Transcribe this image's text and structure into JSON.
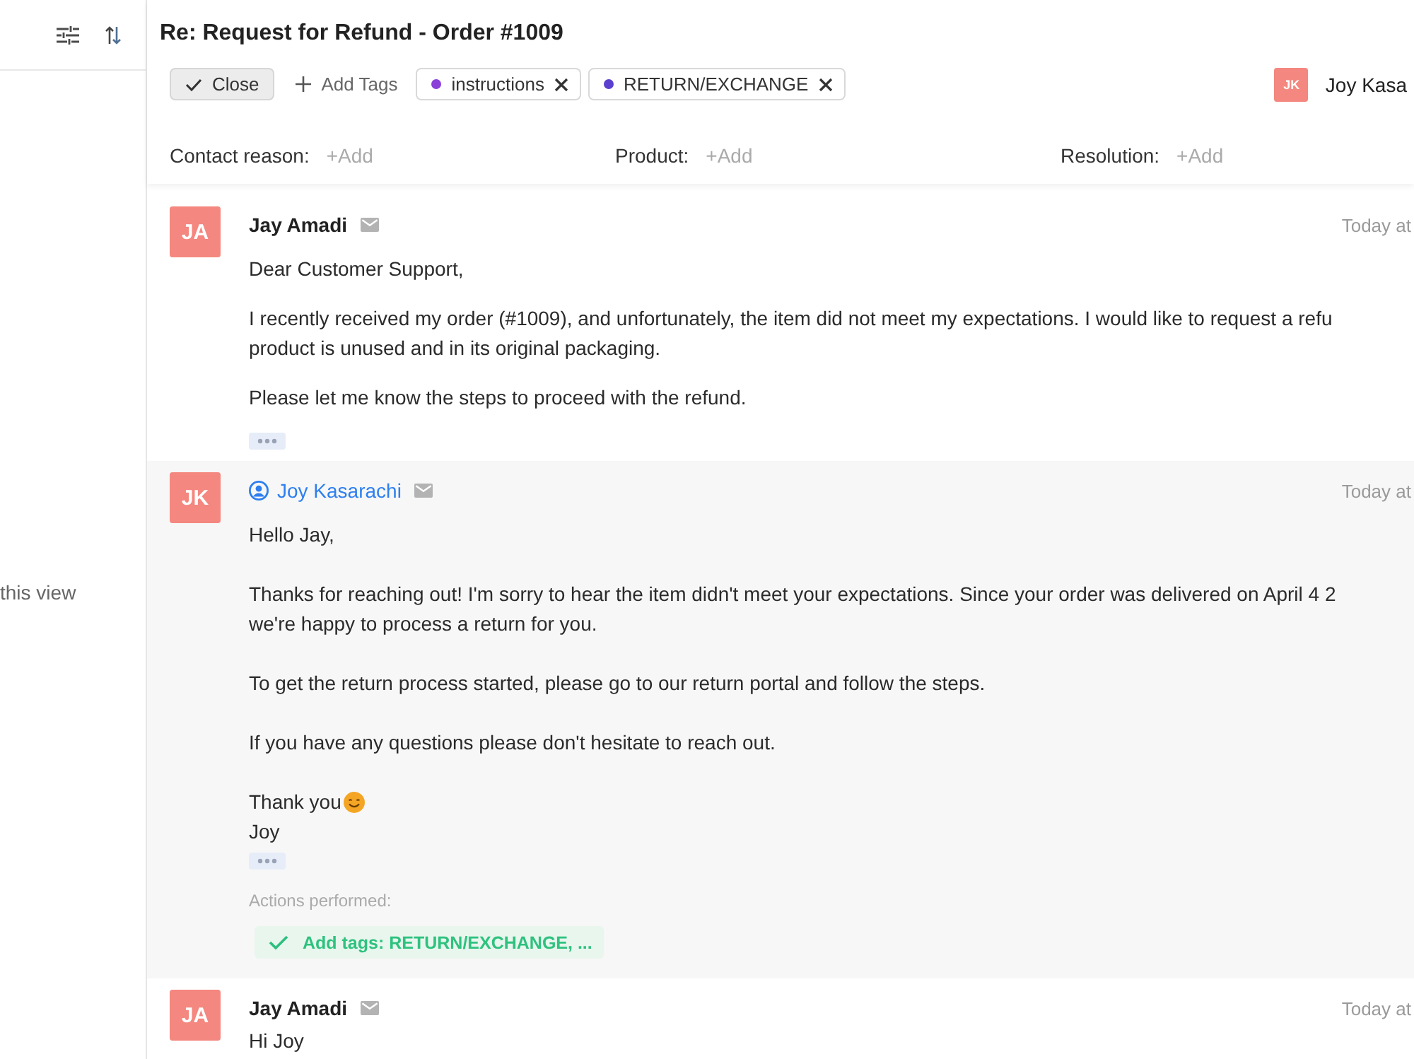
{
  "sidebar": {
    "note": "this view"
  },
  "ticket": {
    "title": "Re: Request for Refund - Order #1009",
    "close_button": "Close",
    "add_tags": "Add Tags",
    "tags": [
      {
        "label": "instructions",
        "color": "#8a3fd8"
      },
      {
        "label": "RETURN/EXCHANGE",
        "color": "#5b40cf"
      }
    ],
    "assignee": {
      "initials": "JK",
      "name": "Joy Kasa"
    },
    "fields": [
      {
        "label": "Contact reason:",
        "action": "+Add"
      },
      {
        "label": "Product:",
        "action": "+Add"
      },
      {
        "label": "Resolution:",
        "action": "+Add"
      }
    ]
  },
  "messages": [
    {
      "kind": "customer",
      "initials": "JA",
      "author": "Jay Amadi",
      "time": "Today at",
      "paragraphs": [
        "Dear Customer Support,",
        "I recently received my order (#1009), and unfortunately, the item did not meet my expectations. I would like to request a refu\nproduct is unused and in its original packaging.",
        "Please let me know the steps to proceed with the refund."
      ],
      "show_more": true
    },
    {
      "kind": "agent",
      "initials": "JK",
      "author": "Joy Kasarachi",
      "time": "Today at",
      "paragraphs": [
        "Hello Jay,",
        "Thanks for reaching out! I'm sorry to hear the item didn't meet your expectations. Since your order was delivered on April 4 2\nwe're happy to process a return for you.",
        "To get the return process started, please go to our return portal and follow the steps.",
        "If you have any questions please don't hesitate to reach out."
      ],
      "closing": "Thank you",
      "signature": "Joy",
      "show_more": true,
      "actions_label": "Actions performed:",
      "actions": [
        "Add tags: RETURN/EXCHANGE, ..."
      ]
    },
    {
      "kind": "customer",
      "initials": "JA",
      "author": "Jay Amadi",
      "time": "Today at",
      "paragraphs": [
        "Hi Joy"
      ]
    }
  ]
}
